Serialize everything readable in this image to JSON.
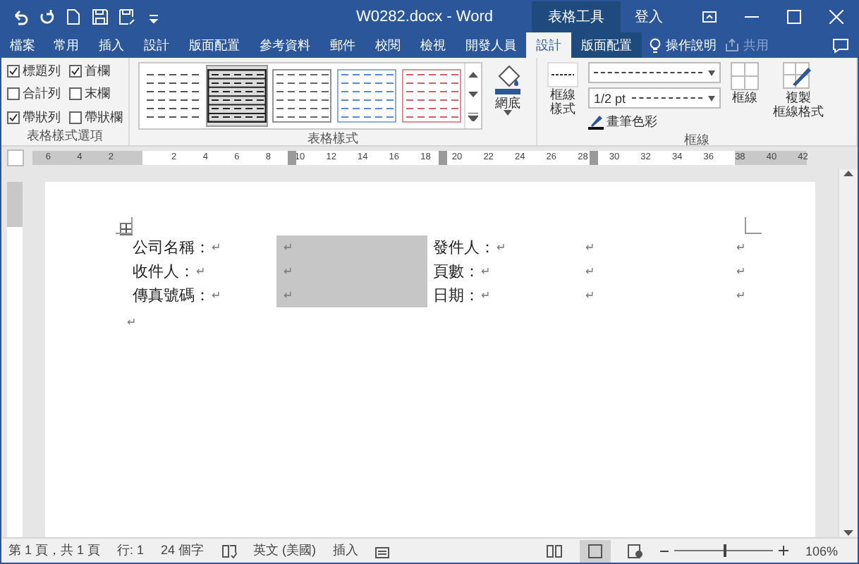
{
  "title_bar": {
    "title": "W0282.docx - Word",
    "context_label": "表格工具",
    "sign_in": "登入"
  },
  "tabs": [
    {
      "label": "檔案",
      "kind": "file",
      "selected": false
    },
    {
      "label": "常用",
      "kind": "normal",
      "selected": false
    },
    {
      "label": "插入",
      "kind": "normal",
      "selected": false
    },
    {
      "label": "設計",
      "kind": "normal",
      "selected": false
    },
    {
      "label": "版面配置",
      "kind": "normal",
      "selected": false
    },
    {
      "label": "參考資料",
      "kind": "normal",
      "selected": false
    },
    {
      "label": "郵件",
      "kind": "normal",
      "selected": false
    },
    {
      "label": "校閱",
      "kind": "normal",
      "selected": false
    },
    {
      "label": "檢視",
      "kind": "normal",
      "selected": false
    },
    {
      "label": "開發人員",
      "kind": "normal",
      "selected": false
    },
    {
      "label": "設計",
      "kind": "context",
      "selected": true
    },
    {
      "label": "版面配置",
      "kind": "context",
      "selected": false
    }
  ],
  "tell_me": "操作說明",
  "share": {
    "label": "共用",
    "disabled": true
  },
  "ribbon": {
    "style_options": {
      "label": "表格樣式選項",
      "items": [
        {
          "label": "標題列",
          "checked": true
        },
        {
          "label": "首欄",
          "checked": true
        },
        {
          "label": "合計列",
          "checked": false
        },
        {
          "label": "末欄",
          "checked": false
        },
        {
          "label": "帶狀列",
          "checked": true
        },
        {
          "label": "帶狀欄",
          "checked": false
        }
      ]
    },
    "table_styles": {
      "label": "表格樣式",
      "items": [
        {
          "kind": "plain",
          "selected": false
        },
        {
          "kind": "grid",
          "selected": true
        },
        {
          "kind": "gray",
          "selected": false
        },
        {
          "kind": "blue",
          "selected": false
        },
        {
          "kind": "red",
          "selected": false
        }
      ]
    },
    "shading": {
      "label": "網底"
    },
    "borders": {
      "label": "框線",
      "border_styles": [
        "框線",
        "樣式"
      ],
      "weight": "1/2 pt",
      "pen_color": "畫筆色彩",
      "border_button": "框線",
      "painter": [
        "複製",
        "框線格式"
      ]
    }
  },
  "ruler": {
    "left_labels": [
      "6",
      "4",
      "2"
    ],
    "right_labels": [
      "2",
      "4",
      "6",
      "8",
      "10",
      "12",
      "14",
      "16",
      "18",
      "20",
      "22",
      "24",
      "26",
      "28",
      "30",
      "32",
      "34",
      "36",
      "38",
      "40",
      "42"
    ]
  },
  "table": {
    "rows": [
      [
        {
          "text": "公司名稱：",
          "mark": "↵"
        },
        {
          "mark": "↵",
          "shaded": true
        },
        {
          "text": "發件人：",
          "mark": "↵"
        },
        {
          "mark": "↵"
        },
        {
          "mark": "↵"
        }
      ],
      [
        {
          "text": "收件人：",
          "mark": "↵"
        },
        {
          "mark": "↵",
          "shaded": true
        },
        {
          "text": "頁數：",
          "mark": "↵"
        },
        {
          "mark": "↵"
        },
        {
          "mark": "↵"
        }
      ],
      [
        {
          "text": "傳真號碼：",
          "mark": "↵"
        },
        {
          "mark": "↵",
          "shaded": true
        },
        {
          "text": "日期：",
          "mark": "↵"
        },
        {
          "mark": "↵"
        },
        {
          "mark": "↵"
        }
      ]
    ],
    "after_mark": "↵"
  },
  "status_bar": {
    "page": "第 1 頁，共 1 頁",
    "line": "行: 1",
    "words": "24 個字",
    "language": "英文 (美國)",
    "mode": "插入",
    "zoom": "106%",
    "level": 0.5
  }
}
